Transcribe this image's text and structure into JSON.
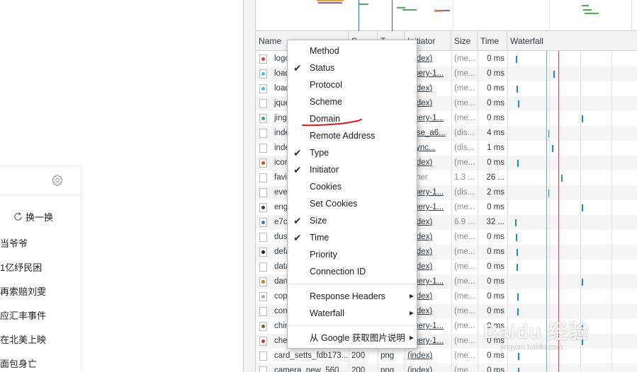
{
  "page": {
    "refresh_label": "换一换",
    "news": [
      "当爷爷",
      "1亿纾民困",
      "再索赔刘雯",
      "应汇丰事件",
      "在北美上映",
      "面包身亡"
    ]
  },
  "devtools": {
    "columns": [
      "Name",
      "S",
      "T",
      "Initiator",
      "Size",
      "Time",
      "Waterfall"
    ],
    "rows": [
      {
        "name": "logo",
        "status": "",
        "type": "",
        "initiator": "(index)",
        "size": "(me...",
        "time": "0 ms",
        "icon": "image",
        "wf": 0.065
      },
      {
        "name": "load",
        "status": "",
        "type": "",
        "initiator": "jquery-1...",
        "size": "(me...",
        "time": "0 ms",
        "icon": "png",
        "wf": 0.35
      },
      {
        "name": "load",
        "status": "",
        "type": "",
        "initiator": "(index)",
        "size": "(me...",
        "time": "0 ms",
        "icon": "png",
        "wf": 0.068
      },
      {
        "name": "jque",
        "status": "",
        "type": "",
        "initiator": "(index)",
        "size": "(me...",
        "time": "0 ms",
        "icon": "doc",
        "wf": 0.08
      },
      {
        "name": "jingo",
        "status": "",
        "type": "",
        "initiator": "jquery-1...",
        "size": "(me...",
        "time": "0 ms",
        "icon": "img2",
        "wf": 0.57
      },
      {
        "name": "inde",
        "status": "",
        "type": "",
        "initiator": "base_a6...",
        "size": "(dis...",
        "time": "4 ms",
        "icon": "doc",
        "wf": 0.314
      },
      {
        "name": "inde",
        "status": "",
        "type": "",
        "initiator": "async...",
        "size": "(dis...",
        "time": "1 ms",
        "icon": "doc",
        "wf": 0.34
      },
      {
        "name": "icon",
        "status": "",
        "type": "",
        "initiator": "(index)",
        "size": "(me...",
        "time": "0 ms",
        "icon": "red",
        "wf": 0.077
      },
      {
        "name": "favic",
        "status": "",
        "type": "",
        "initiator": "Other",
        "size": "1.3 ...",
        "time": "26 ...",
        "icon": "doc",
        "wf": 0.409
      },
      {
        "name": "even",
        "status": "",
        "type": "",
        "initiator": "jquery-1...",
        "size": "(dis...",
        "time": "2 ms",
        "icon": "doc",
        "wf": 0.314
      },
      {
        "name": "engli",
        "status": "",
        "type": "",
        "initiator": "jquery-1...",
        "size": "(me...",
        "time": "0 ms",
        "icon": "img3",
        "wf": 0.57
      },
      {
        "name": "e7cc",
        "status": "",
        "type": "",
        "initiator": "(index)",
        "size": "6.9 ...",
        "time": "32 ...",
        "icon": "img4",
        "wf": 0.062
      },
      {
        "name": "dust",
        "status": "",
        "type": "",
        "initiator": "(index)",
        "size": "(me...",
        "time": "0 ms",
        "icon": "doc",
        "wf": 0.066
      },
      {
        "name": "defa",
        "status": "",
        "type": "",
        "initiator": "(index)",
        "size": "(me...",
        "time": "0 ms",
        "icon": "dark",
        "wf": 0.07
      },
      {
        "name": "data",
        "status": "",
        "type": "",
        "initiator": "(index)",
        "size": "(me...",
        "time": "0 ms",
        "icon": "doc",
        "wf": 0.07
      },
      {
        "name": "dans",
        "status": "",
        "type": "",
        "initiator": "jquery-1...",
        "size": "(me...",
        "time": "0 ms",
        "icon": "img5",
        "wf": 0.57
      },
      {
        "name": "copy",
        "status": "",
        "type": "",
        "initiator": "(index)",
        "size": "(me...",
        "time": "0 ms",
        "icon": "grey",
        "wf": 0.073
      },
      {
        "name": "conf",
        "status": "",
        "type": "",
        "initiator": "(index)",
        "size": "(me...",
        "time": "0 ms",
        "icon": "doc",
        "wf": 0.073
      },
      {
        "name": "chin",
        "status": "",
        "type": "",
        "initiator": "jquery-1...",
        "size": "(me...",
        "time": "0 ms",
        "icon": "img6",
        "wf": 0.57
      },
      {
        "name": "cher",
        "status": "",
        "type": "",
        "initiator": "jquery-1...",
        "size": "(me...",
        "time": "0 ms",
        "icon": "img7",
        "wf": 0.57
      },
      {
        "name": "card_setts_fdb173...",
        "status": "200",
        "type": "png",
        "initiator": "(index)",
        "size": "(me...",
        "time": "0 ms",
        "icon": "doc",
        "wf": 0.08
      },
      {
        "name": "camera_new_560...",
        "status": "200",
        "type": "png",
        "initiator": "(index)",
        "size": "(me...",
        "time": "0 ms",
        "icon": "doc",
        "wf": 0.08
      }
    ]
  },
  "menu": {
    "items": [
      {
        "label": "Method",
        "checked": false
      },
      {
        "label": "Status",
        "checked": true
      },
      {
        "label": "Protocol",
        "checked": false
      },
      {
        "label": "Scheme",
        "checked": false
      },
      {
        "label": "Domain",
        "checked": false
      },
      {
        "label": "Remote Address",
        "checked": false
      },
      {
        "label": "Type",
        "checked": true
      },
      {
        "label": "Initiator",
        "checked": true
      },
      {
        "label": "Cookies",
        "checked": false
      },
      {
        "label": "Set Cookies",
        "checked": false
      },
      {
        "label": "Size",
        "checked": true
      },
      {
        "label": "Time",
        "checked": true
      },
      {
        "label": "Priority",
        "checked": false
      },
      {
        "label": "Connection ID",
        "checked": false
      }
    ],
    "submenus": [
      {
        "label": "Response Headers"
      },
      {
        "label": "Waterfall"
      }
    ],
    "google_label": "从 Google 获取图片说明"
  },
  "watermark": {
    "main": "Baidu 经验",
    "sub": "jingyan.baidu.com"
  },
  "colors": {
    "accent_blue": "#1a8ad4",
    "load_red": "#e0403f",
    "dom_blue": "#2a7fd4",
    "annotation": "#e0161b"
  }
}
